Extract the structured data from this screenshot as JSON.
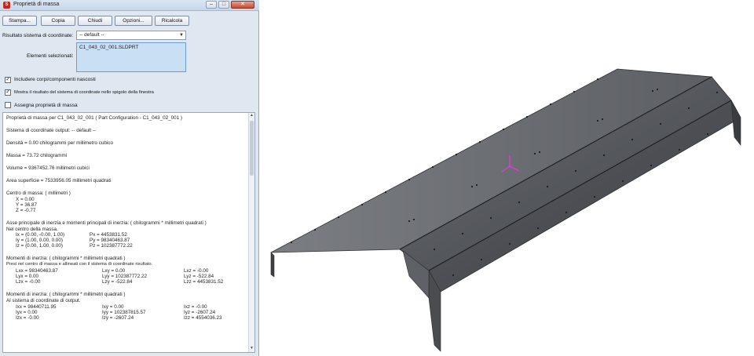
{
  "window": {
    "title": "Proprietà di massa",
    "app_icon": "solidworks-icon",
    "controls": {
      "minimize": "–",
      "maximize": "□",
      "close": "✕"
    }
  },
  "toolbar": {
    "print_label": "Stampa...",
    "copy_label": "Copia",
    "close_label": "Chiudi",
    "options_label": "Opzioni...",
    "recalc_label": "Ricalcola"
  },
  "coords": {
    "label": "Risultato sistema di coordinate:",
    "value": "-- default --"
  },
  "selected": {
    "label": "Elementi selezionati:",
    "item": "C1_043_02_001.SLDPRT"
  },
  "options": [
    {
      "label": "Includere corpi/componenti nascosti",
      "checked": "✓"
    },
    {
      "label": "Mostra il risultato del sistema di coordinate nello spigolo della finestra",
      "checked": "✓"
    },
    {
      "label": "Assegna proprietà di massa",
      "checked": ""
    }
  ],
  "results": {
    "header": "Proprietà di massa per C1_043_02_001 ( Part Configuration - C1_043_02_001 )",
    "coord_system": "Sistema di coordinate output: -- default --",
    "density": "Densità = 0.00 chilogrammi per  millimetro cubico",
    "mass": "Massa = 73.72 chilogrammi",
    "volume": "Volume = 9367452.76  millimetri cubici",
    "area": "Area superficie = 7533956.05  millimetri quadrati",
    "com_header": "Centro di massa: ( millimetri )",
    "com_x": "X = 0.00",
    "com_y": "Y = 36.87",
    "com_z": "Z = -0.77",
    "principal_header": "Asse principale di inerzia e momenti principali di inerzia: ( chilogrammi * millimetri quadrati )",
    "principal_sub": "Nel centro della massa.",
    "principal_rows": [
      {
        "axis": "Ix = (0.00, -0.00, 1.00)",
        "moment": "Px = 4453831.52"
      },
      {
        "axis": "Iy = (1.00, 0.00, 0.00)",
        "moment": "Py = 98340463.87"
      },
      {
        "axis": "Iz = (0.00, 1.00, 0.00)",
        "moment": "Pz = 102387772.22"
      }
    ],
    "moments_center_header": "Momenti di inerzia: ( chilogrammi * millimetri quadrati )",
    "moments_center_sub": "Presi nel centro di massa e allineati con il sistema di coordinate risultato.",
    "moments_center_rows": [
      [
        "Lxx = 98340463.87",
        "Lxy = 0.00",
        "Lxz = -0.00"
      ],
      [
        "Lyx = 0.00",
        "Lyy = 102387772.22",
        "Lyz = -522.84"
      ],
      [
        "Lzx = -0.00",
        "Lzy = -522.84",
        "Lzz = 4453831.52"
      ]
    ],
    "moments_output_header": "Momenti di inerzia: ( chilogrammi * millimetri quadrati )",
    "moments_output_sub": "Al sistema di coordinate di output.",
    "moments_output_rows": [
      [
        "Ixx = 98440711.95",
        "Ixy = 0.00",
        "Ixz = -0.00"
      ],
      [
        "Iyx = 0.00",
        "Iyy = 102387815.57",
        "Iyz = -2607.24"
      ],
      [
        "Izx = -0.00",
        "Izy = -2607.24",
        "Izz = 4554036.23"
      ]
    ]
  },
  "colors": {
    "dialog_bg": "#dfe7f1",
    "selection_bg": "#c9dff3",
    "steel_dark": "#4a4c50",
    "steel_light": "#7a7d82",
    "triad_pink": "#e23ad6"
  }
}
